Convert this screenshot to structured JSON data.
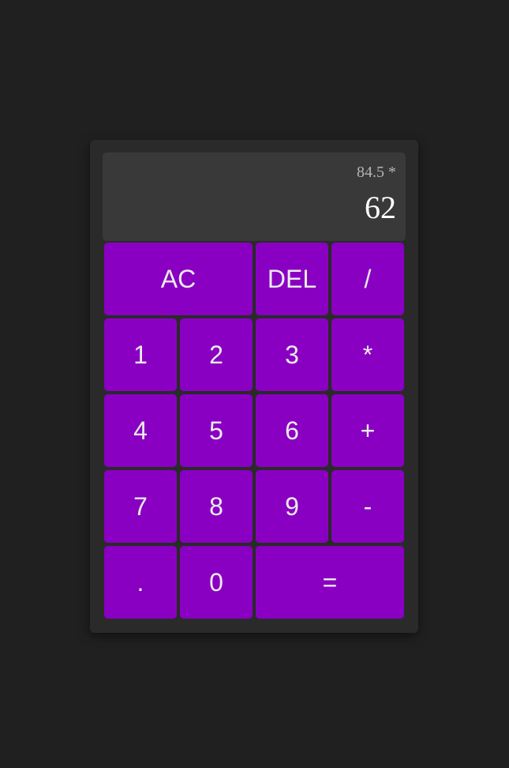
{
  "display": {
    "previous": "84.5 *",
    "current": "62"
  },
  "keys": {
    "ac": "AC",
    "del": "DEL",
    "divide": "/",
    "one": "1",
    "two": "2",
    "three": "3",
    "multiply": "*",
    "four": "4",
    "five": "5",
    "six": "6",
    "plus": "+",
    "seven": "7",
    "eight": "8",
    "nine": "9",
    "minus": "-",
    "dot": ".",
    "zero": "0",
    "equals": "="
  },
  "colors": {
    "background": "#202020",
    "panel": "#2a2a2a",
    "display": "#393939",
    "key": "#8a00c2",
    "key_text": "#ececec"
  }
}
